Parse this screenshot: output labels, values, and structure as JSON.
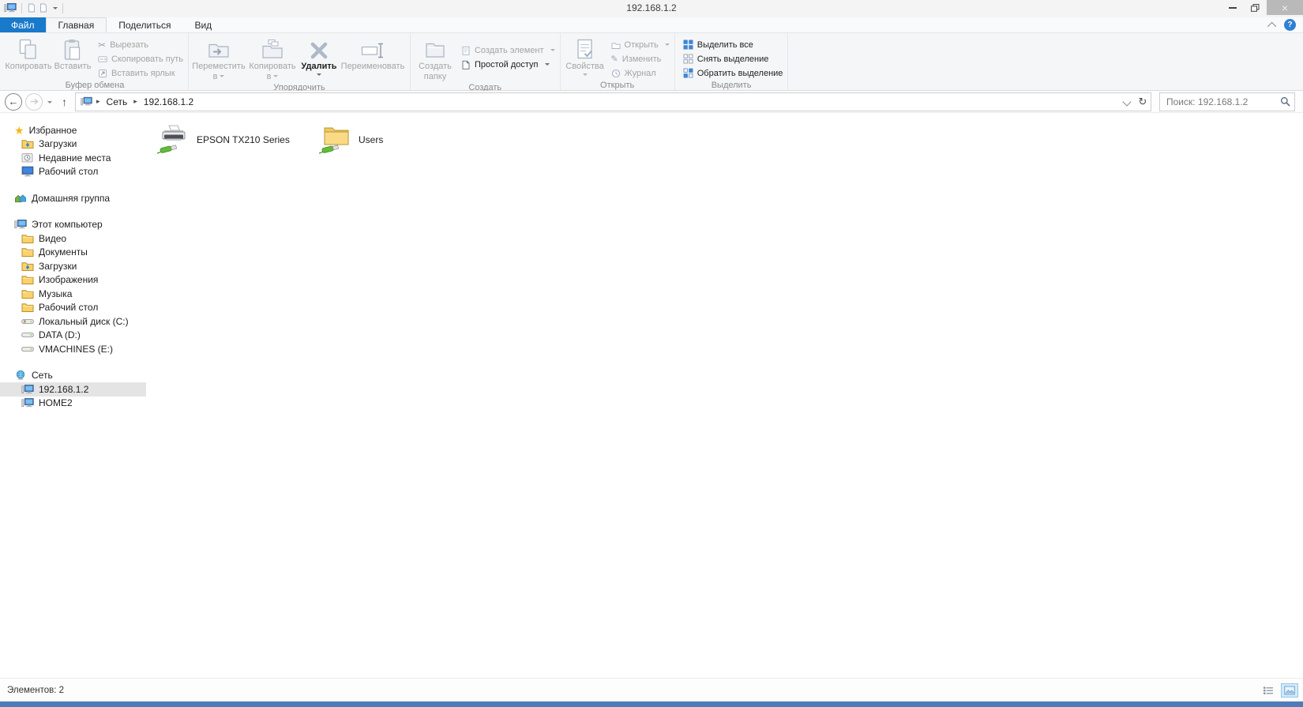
{
  "window": {
    "title": "192.168.1.2"
  },
  "icons": {
    "back": "←",
    "up": "↑",
    "refresh": "↻",
    "close": "×",
    "breadcrumb_sep": "▸",
    "help": "?",
    "cut": "✂",
    "edit_glyph": "✎",
    "star": "★"
  },
  "tabs": {
    "file": "Файл",
    "items": [
      {
        "label": "Главная",
        "active": true
      },
      {
        "label": "Поделиться",
        "active": false
      },
      {
        "label": "Вид",
        "active": false
      }
    ]
  },
  "ribbon": {
    "groups": [
      {
        "label": "Буфер обмена",
        "large": [
          {
            "label": "Копировать"
          },
          {
            "label": "Вставить"
          }
        ],
        "small": [
          {
            "label": "Вырезать"
          },
          {
            "label": "Скопировать путь"
          },
          {
            "label": "Вставить ярлык"
          }
        ]
      },
      {
        "label": "Упорядочить",
        "large": [
          {
            "label": "Переместить в"
          },
          {
            "label": "Копировать в"
          },
          {
            "label": "Удалить"
          },
          {
            "label": "Переименовать"
          }
        ]
      },
      {
        "label": "Создать",
        "large": [
          {
            "label": "Создать папку"
          }
        ],
        "small": [
          {
            "label": "Создать элемент"
          },
          {
            "label": "Простой доступ"
          }
        ]
      },
      {
        "label": "Открыть",
        "large": [
          {
            "label": "Свойства"
          }
        ],
        "small": [
          {
            "label": "Открыть"
          },
          {
            "label": "Изменить"
          },
          {
            "label": "Журнал"
          }
        ]
      },
      {
        "label": "Выделить",
        "small": [
          {
            "label": "Выделить все"
          },
          {
            "label": "Снять выделение"
          },
          {
            "label": "Обратить выделение"
          }
        ]
      }
    ]
  },
  "address": {
    "breadcrumb": [
      "Сеть",
      "192.168.1.2"
    ],
    "search_placeholder": "Поиск: 192.168.1.2"
  },
  "sidebar": {
    "sections": [
      {
        "label": "Избранное",
        "items": [
          "Загрузки",
          "Недавние места",
          "Рабочий стол"
        ]
      },
      {
        "label": "Домашняя группа",
        "items": []
      },
      {
        "label": "Этот компьютер",
        "items": [
          "Видео",
          "Документы",
          "Загрузки",
          "Изображения",
          "Музыка",
          "Рабочий стол",
          "Локальный диск (C:)",
          "DATA (D:)",
          "VMACHINES (E:)"
        ]
      },
      {
        "label": "Сеть",
        "items": [
          "192.168.1.2",
          "HOME2"
        ],
        "selected_item": "192.168.1.2"
      }
    ]
  },
  "content": {
    "items": [
      {
        "label": "EPSON TX210 Series",
        "type": "network-printer"
      },
      {
        "label": "Users",
        "type": "network-folder"
      }
    ]
  },
  "statusbar": {
    "count": "Элементов: 2"
  },
  "colors": {
    "file_tab_blue": "#1979ca",
    "selection_grey": "#e4e4e4",
    "folder_yellow": "#f2c95e",
    "cable_green": "#62bd3a",
    "select_icon_blue": "#3f86d2",
    "help_blue": "#2f80d4",
    "window_border_blue": "#4f7cb8"
  }
}
